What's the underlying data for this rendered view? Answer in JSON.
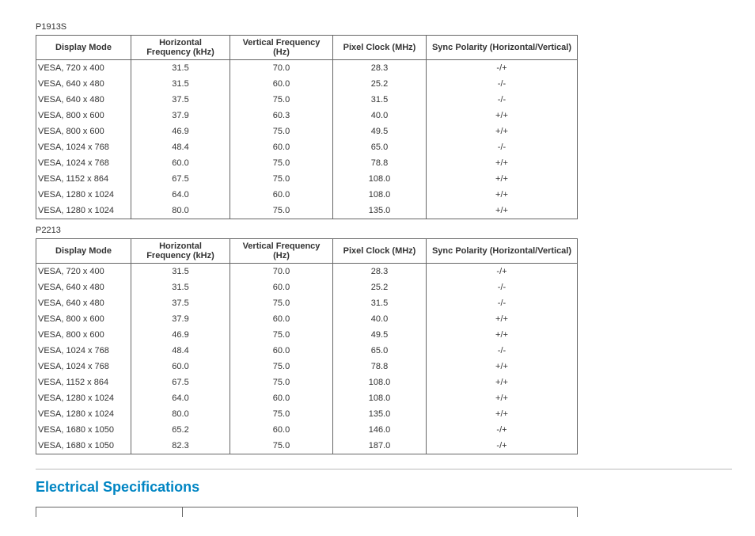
{
  "table1": {
    "label": "P1913S",
    "headers": [
      "Display Mode",
      "Horizontal Frequency (kHz)",
      "Vertical Frequency (Hz)",
      "Pixel Clock (MHz)",
      "Sync Polarity (Horizontal/Vertical)"
    ],
    "rows": [
      [
        "VESA, 720 x 400",
        "31.5",
        "70.0",
        "28.3",
        "-/+"
      ],
      [
        "VESA, 640 x 480",
        "31.5",
        "60.0",
        "25.2",
        "-/-"
      ],
      [
        "VESA, 640 x 480",
        "37.5",
        "75.0",
        "31.5",
        "-/-"
      ],
      [
        "VESA, 800 x 600",
        "37.9",
        "60.3",
        "40.0",
        "+/+"
      ],
      [
        "VESA, 800 x 600",
        "46.9",
        "75.0",
        "49.5",
        "+/+"
      ],
      [
        "VESA, 1024 x 768",
        "48.4",
        "60.0",
        "65.0",
        "-/-"
      ],
      [
        "VESA, 1024 x 768",
        "60.0",
        "75.0",
        "78.8",
        "+/+"
      ],
      [
        "VESA, 1152 x 864",
        "67.5",
        "75.0",
        "108.0",
        "+/+"
      ],
      [
        "VESA, 1280 x 1024",
        "64.0",
        "60.0",
        "108.0",
        "+/+"
      ],
      [
        "VESA, 1280 x 1024",
        "80.0",
        "75.0",
        "135.0",
        "+/+"
      ]
    ]
  },
  "table2": {
    "label": "P2213",
    "headers": [
      "Display Mode",
      "Horizontal Frequency (kHz)",
      "Vertical Frequency (Hz)",
      "Pixel Clock (MHz)",
      "Sync Polarity (Horizontal/Vertical)"
    ],
    "rows": [
      [
        "VESA, 720 x 400",
        "31.5",
        "70.0",
        "28.3",
        "-/+"
      ],
      [
        "VESA, 640 x 480",
        "31.5",
        "60.0",
        "25.2",
        "-/-"
      ],
      [
        "VESA, 640 x 480",
        "37.5",
        "75.0",
        "31.5",
        "-/-"
      ],
      [
        "VESA, 800 x 600",
        "37.9",
        "60.0",
        "40.0",
        "+/+"
      ],
      [
        "VESA, 800 x 600",
        "46.9",
        "75.0",
        "49.5",
        "+/+"
      ],
      [
        "VESA, 1024 x 768",
        "48.4",
        "60.0",
        "65.0",
        "-/-"
      ],
      [
        "VESA, 1024 x 768",
        "60.0",
        "75.0",
        "78.8",
        "+/+"
      ],
      [
        "VESA, 1152 x 864",
        "67.5",
        "75.0",
        "108.0",
        "+/+"
      ],
      [
        "VESA, 1280 x 1024",
        "64.0",
        "60.0",
        "108.0",
        "+/+"
      ],
      [
        "VESA, 1280 x 1024",
        "80.0",
        "75.0",
        "135.0",
        "+/+"
      ],
      [
        "VESA, 1680 x 1050",
        "65.2",
        "60.0",
        "146.0",
        "-/+"
      ],
      [
        "VESA, 1680 x 1050",
        "82.3",
        "75.0",
        "187.0",
        "-/+"
      ]
    ]
  },
  "section_heading": "Electrical Specifications",
  "colwidths": [
    "120",
    "125",
    "130",
    "118",
    ""
  ]
}
